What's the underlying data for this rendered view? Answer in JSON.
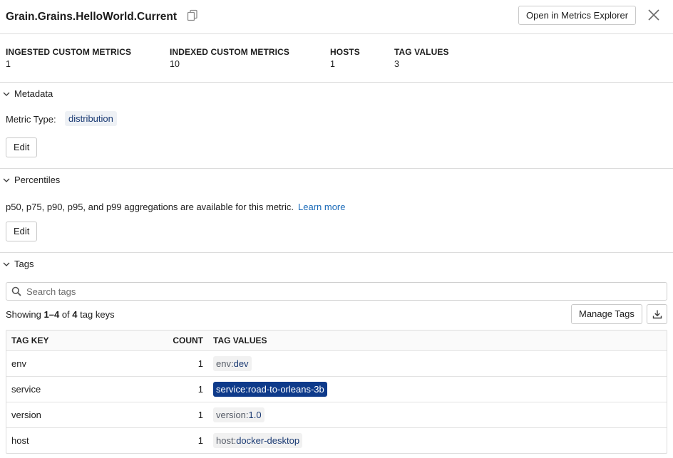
{
  "header": {
    "title": "Grain.Grains.HelloWorld.Current",
    "explorer_button": "Open in Metrics Explorer"
  },
  "stats": [
    {
      "label": "INGESTED CUSTOM METRICS",
      "value": "1"
    },
    {
      "label": "INDEXED CUSTOM METRICS",
      "value": "10"
    },
    {
      "label": "HOSTS",
      "value": "1"
    },
    {
      "label": "TAG VALUES",
      "value": "3"
    }
  ],
  "metadata": {
    "title": "Metadata",
    "metric_type_label": "Metric Type:",
    "metric_type_value": "distribution",
    "edit_label": "Edit"
  },
  "percentiles": {
    "title": "Percentiles",
    "description": "p50, p75, p90, p95, and p99 aggregations are available for this metric.",
    "learn_more": "Learn more",
    "edit_label": "Edit"
  },
  "tags": {
    "title": "Tags",
    "search_placeholder": "Search tags",
    "showing_prefix": "Showing",
    "showing_range": "1–4",
    "showing_of": "of",
    "showing_total": "4",
    "showing_suffix": "tag keys",
    "manage_button": "Manage Tags",
    "columns": {
      "key": "TAG KEY",
      "count": "COUNT",
      "values": "TAG VALUES"
    },
    "rows": [
      {
        "key": "env",
        "count": "1",
        "tag_key": "env",
        "sep": ":",
        "tag_value": "dev"
      },
      {
        "key": "service",
        "count": "1",
        "tag_key": "service",
        "sep": ":",
        "tag_value": "road-to-orleans-3b"
      },
      {
        "key": "version",
        "count": "1",
        "tag_key": "version",
        "sep": ":",
        "tag_value": "1.0"
      },
      {
        "key": "host",
        "count": "1",
        "tag_key": "host",
        "sep": ":",
        "tag_value": "docker-desktop"
      }
    ]
  },
  "colors": {
    "link": "#1a6ab8",
    "chip_text": "#1a3a73",
    "chip_selected_bg": "#0e3a8a",
    "divider": "#dcdcdc"
  }
}
